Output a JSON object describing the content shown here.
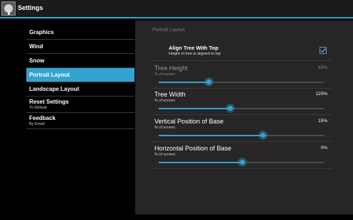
{
  "actionbar": {
    "title": "Settings",
    "icon": "tree-app-icon"
  },
  "sidebar": {
    "items": [
      {
        "label": "Graphics",
        "sub": ""
      },
      {
        "label": "Wind",
        "sub": ""
      },
      {
        "label": "Snow",
        "sub": ""
      },
      {
        "label": "Portrait Layout",
        "sub": "",
        "selected": true
      },
      {
        "label": "Landscape Layout",
        "sub": ""
      },
      {
        "label": "Reset Settings",
        "sub": "To Default"
      },
      {
        "label": "Feedback",
        "sub": "By Email"
      }
    ]
  },
  "panel": {
    "header": "Portrait Layout",
    "align": {
      "title": "Align Tree With Top",
      "summary": "Height of tree is aligned to top",
      "checked": true
    },
    "prefs": [
      {
        "title": "Tree Height",
        "summary": "% of screen",
        "value": "65%",
        "level": 0.3,
        "enabled": false
      },
      {
        "title": "Tree Width",
        "summary": "% of screen",
        "value": "120%",
        "level": 0.43,
        "enabled": true
      },
      {
        "title": "Vertical Position of Base",
        "summary": "% of screen",
        "value": "15%",
        "level": 0.625,
        "enabled": true
      },
      {
        "title": "Horizontal Position of Base",
        "summary": "% of screen",
        "value": "0%",
        "level": 0.5,
        "enabled": true
      }
    ]
  },
  "colors": {
    "accent": "#33a3d0",
    "panel": "#262626",
    "background": "#000000"
  }
}
